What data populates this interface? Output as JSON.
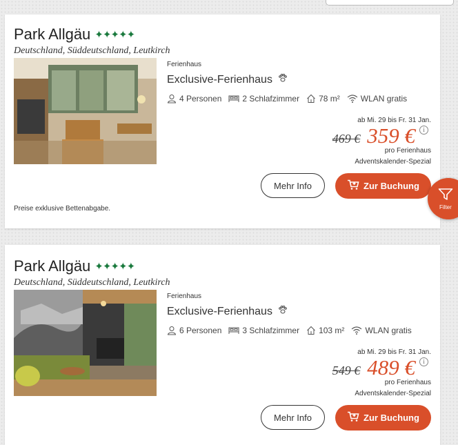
{
  "cards": [
    {
      "park_name": "Park Allgäu",
      "location": "Deutschland, Süddeutschland, Leutkirch",
      "type": "Ferienhaus",
      "title": "Exclusive-Ferienhaus",
      "persons": "4 Personen",
      "bedrooms": "2 Schlafzimmer",
      "area": "78 m²",
      "wifi": "WLAN gratis",
      "date_range": "ab Mi. 29 bis Fr. 31 Jan.",
      "old_price": "469 €",
      "new_price": "359 €",
      "per_unit": "pro Ferienhaus",
      "special": "Adventskalender-Spezial",
      "more_info_label": "Mehr Info",
      "book_label": "Zur Buchung",
      "footnote": "Preise exklusive Bettenabgabe.",
      "rating_stars": 5
    },
    {
      "park_name": "Park Allgäu",
      "location": "Deutschland, Süddeutschland, Leutkirch",
      "type": "Ferienhaus",
      "title": "Exclusive-Ferienhaus",
      "persons": "6 Personen",
      "bedrooms": "3 Schlafzimmer",
      "area": "103 m²",
      "wifi": "WLAN gratis",
      "date_range": "ab Mi. 29 bis Fr. 31 Jan.",
      "old_price": "549 €",
      "new_price": "489 €",
      "per_unit": "pro Ferienhaus",
      "special": "Adventskalender-Spezial",
      "more_info_label": "Mehr Info",
      "book_label": "Zur Buchung",
      "rating_stars": 5
    }
  ],
  "filter": {
    "label": "Filter"
  },
  "colors": {
    "accent": "#d94f2a",
    "stars": "#1b7a3e"
  }
}
